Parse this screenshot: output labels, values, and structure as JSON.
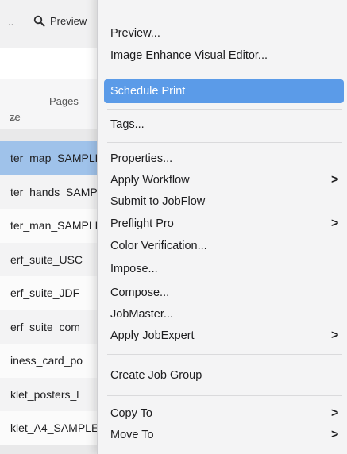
{
  "toolbar": {
    "overflow_label": "..",
    "preview_label": "Preview"
  },
  "columns": {
    "size_label": "ze",
    "pages_label": "Pages"
  },
  "files": [
    {
      "name": "ter_map_SAMPLE",
      "selected": true
    },
    {
      "name": "ter_hands_SAMPLE",
      "selected": false
    },
    {
      "name": "ter_man_SAMPLE",
      "selected": false
    },
    {
      "name": "erf_suite_USC",
      "selected": false
    },
    {
      "name": "erf_suite_JDF",
      "selected": false
    },
    {
      "name": "erf_suite_com",
      "selected": false
    },
    {
      "name": "iness_card_po",
      "selected": false
    },
    {
      "name": "klet_posters_l",
      "selected": false
    },
    {
      "name": "klet_A4_SAMPLE",
      "selected": false
    }
  ],
  "menu": {
    "items": [
      {
        "label": "Preview..."
      },
      {
        "label": "Image Enhance Visual Editor..."
      },
      {
        "label": "Schedule Print",
        "highlighted": true
      },
      {
        "label": "Tags..."
      },
      {
        "label": "Properties..."
      },
      {
        "label": "Apply Workflow",
        "submenu": true
      },
      {
        "label": "Submit to JobFlow"
      },
      {
        "label": "Preflight Pro",
        "submenu": true
      },
      {
        "label": "Color Verification..."
      },
      {
        "label": "Impose..."
      },
      {
        "label": "Compose..."
      },
      {
        "label": "JobMaster..."
      },
      {
        "label": "Apply JobExpert",
        "submenu": true
      },
      {
        "label": "Create Job Group"
      },
      {
        "label": "Copy To",
        "submenu": true
      },
      {
        "label": "Move To",
        "submenu": true
      }
    ],
    "submenu_arrow": ">"
  },
  "colors": {
    "highlight": "#5b9be8",
    "selected_row": "#9fc2ea",
    "menu_bg": "#f4f4f5"
  }
}
